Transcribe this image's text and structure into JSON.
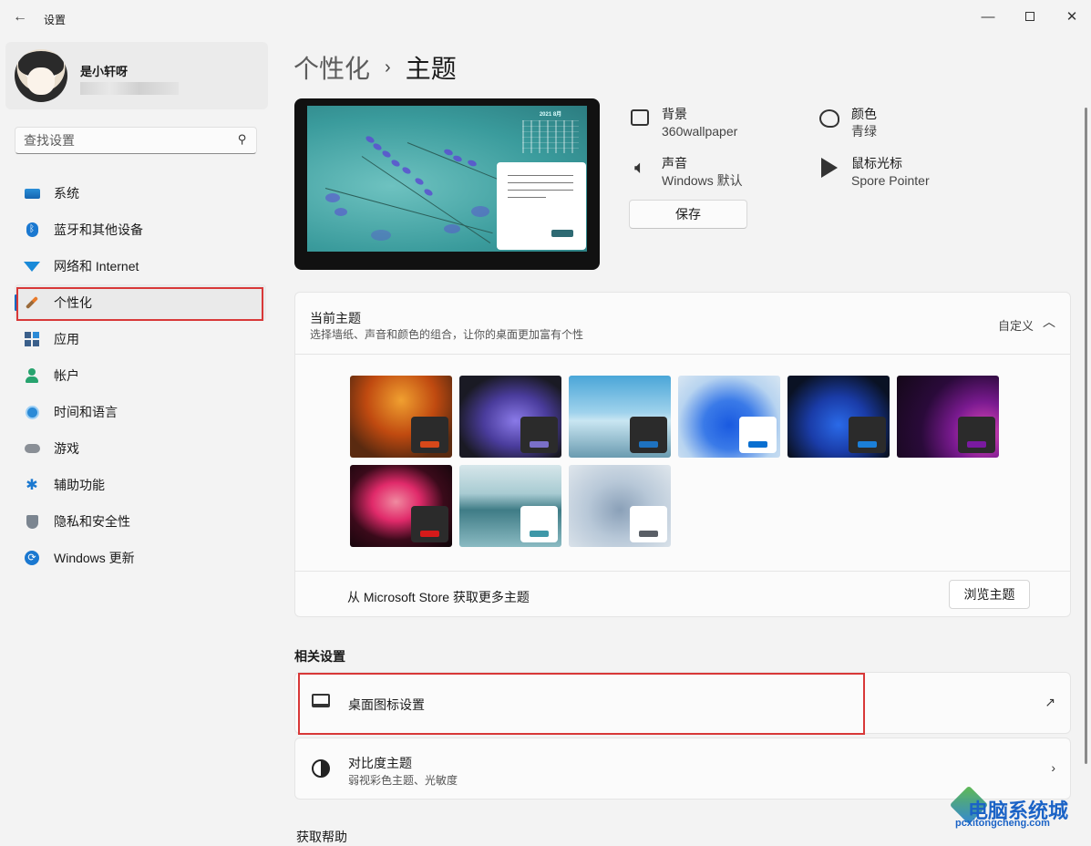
{
  "window": {
    "title": "设置",
    "back_icon": "arrow-left-icon",
    "controls": [
      "minimize",
      "maximize",
      "close"
    ]
  },
  "profile": {
    "name": "是小轩呀"
  },
  "search": {
    "placeholder": "查找设置"
  },
  "sidebar": {
    "items": [
      {
        "label": "系统",
        "icon": "system-icon"
      },
      {
        "label": "蓝牙和其他设备",
        "icon": "bluetooth-icon"
      },
      {
        "label": "网络和 Internet",
        "icon": "wifi-icon"
      },
      {
        "label": "个性化",
        "icon": "brush-icon",
        "active": true
      },
      {
        "label": "应用",
        "icon": "apps-icon"
      },
      {
        "label": "帐户",
        "icon": "person-icon"
      },
      {
        "label": "时间和语言",
        "icon": "globe-clock-icon"
      },
      {
        "label": "游戏",
        "icon": "gamepad-icon"
      },
      {
        "label": "辅助功能",
        "icon": "accessibility-icon"
      },
      {
        "label": "隐私和安全性",
        "icon": "shield-icon"
      },
      {
        "label": "Windows 更新",
        "icon": "update-icon"
      }
    ]
  },
  "breadcrumb": {
    "parent": "个性化",
    "separator": "›",
    "current": "主题"
  },
  "theme_summary": {
    "background": {
      "title": "背景",
      "value": "360wallpaper"
    },
    "color": {
      "title": "颜色",
      "value": "青绿"
    },
    "sound": {
      "title": "声音",
      "value": "Windows 默认"
    },
    "cursor": {
      "title": "鼠标光标",
      "value": "Spore Pointer"
    },
    "save_label": "保存",
    "preview_calendar": "2021 8月"
  },
  "current_theme": {
    "title": "当前主题",
    "subtitle": "选择墙纸、声音和颜色的组合，让你的桌面更加富有个性",
    "state": "自定义",
    "themes": [
      {
        "name": "autumn",
        "accent": "#d6481a",
        "mini": "dark"
      },
      {
        "name": "glow-purple",
        "accent": "#7a6fc8",
        "mini": "dark"
      },
      {
        "name": "sky",
        "accent": "#1e72c0",
        "mini": "dark"
      },
      {
        "name": "bloom-light",
        "accent": "#0a6fd0",
        "mini": "light"
      },
      {
        "name": "bloom-dark",
        "accent": "#1b7fd8",
        "mini": "dark"
      },
      {
        "name": "purple-planet",
        "accent": "#7a1aa0",
        "mini": "dark"
      },
      {
        "name": "flower",
        "accent": "#d61a1a",
        "mini": "dark"
      },
      {
        "name": "lake",
        "accent": "#3f98a8",
        "mini": "light"
      },
      {
        "name": "bloom-gray",
        "accent": "#5a5f66",
        "mini": "light"
      }
    ],
    "store_text": "从 Microsoft Store 获取更多主题",
    "browse_label": "浏览主题"
  },
  "related": {
    "title": "相关设置",
    "items": [
      {
        "title": "桌面图标设置",
        "icon": "monitor-icon",
        "action_icon": "external-link-icon"
      },
      {
        "title": "对比度主题",
        "subtitle": "弱视彩色主题、光敏度",
        "icon": "contrast-icon",
        "action_icon": "chevron-right-icon"
      }
    ]
  },
  "footer": {
    "help": "获取帮助"
  },
  "watermark": {
    "main": "电脑系统城",
    "sub": "pcxitongcheng.com"
  }
}
